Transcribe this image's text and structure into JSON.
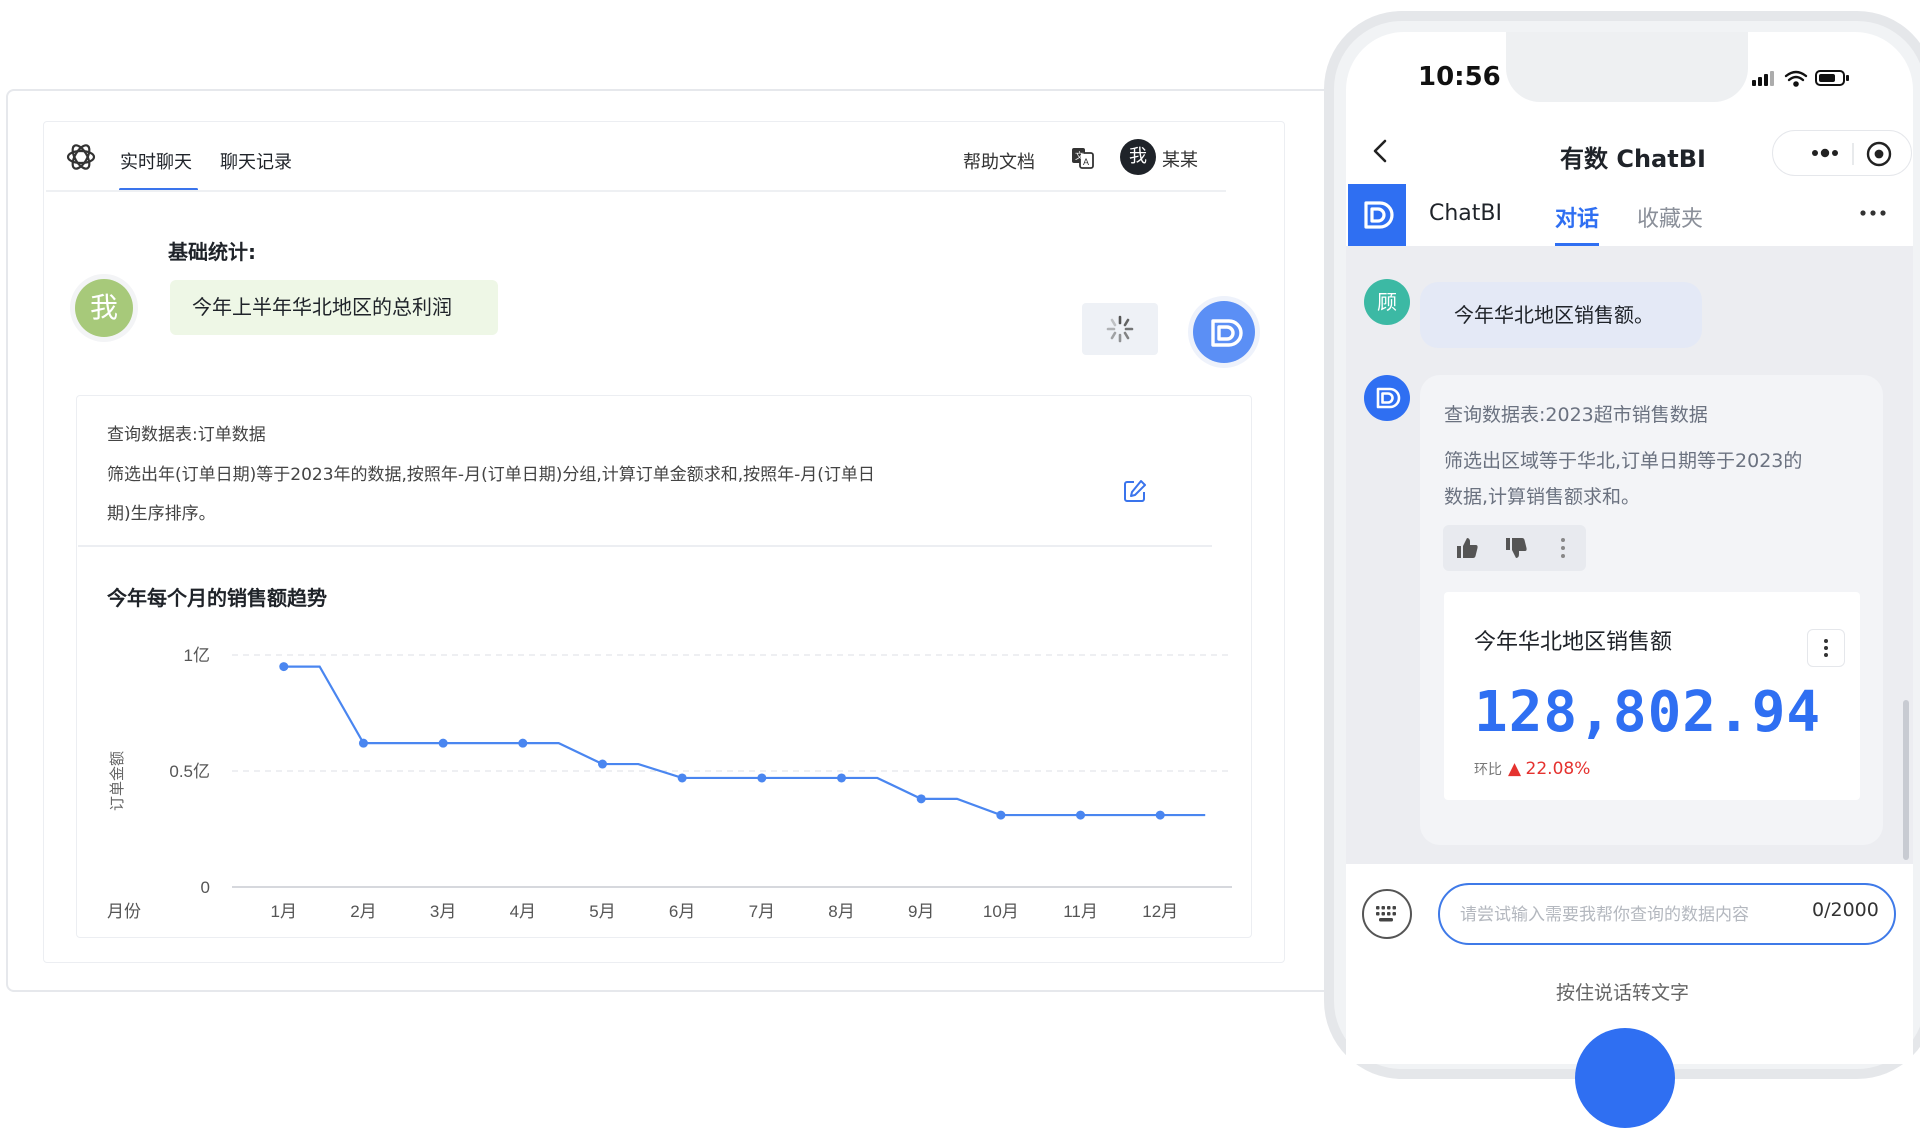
{
  "desktop": {
    "tabs": [
      {
        "label": "实时聊天",
        "active": true
      },
      {
        "label": "聊天记录",
        "active": false
      }
    ],
    "help_label": "帮助文档",
    "user": {
      "avatar_text": "我",
      "name": "某某"
    },
    "section_title": "基础统计:",
    "user_avatar_text": "我",
    "user_message": "今年上半年华北地区的总利润",
    "query": {
      "line1": "查询数据表:订单数据",
      "line2": "筛选出年(订单日期)等于2023年的数据,按照年-月(订单日期)分组,计算订单金额求和,按照年-月(订单日",
      "line3": "期)生序排序。"
    }
  },
  "chart_data": {
    "type": "line",
    "title": "今年每个月的销售额趋势",
    "xlabel": "月份",
    "ylabel": "订单金额",
    "categories": [
      "1月",
      "2月",
      "3月",
      "4月",
      "5月",
      "6月",
      "7月",
      "8月",
      "9月",
      "10月",
      "11月",
      "12月"
    ],
    "series": [
      {
        "values": [
          0.95,
          0.62,
          0.62,
          0.62,
          0.53,
          0.47,
          0.47,
          0.47,
          0.38,
          0.31,
          0.31,
          0.31
        ]
      }
    ],
    "y_tick_labels": [
      "0",
      "0.5亿",
      "1亿"
    ],
    "ylim": [
      0,
      1
    ],
    "grid": true,
    "color": "#4a86f0"
  },
  "phone": {
    "time": "10:56",
    "nav_title": "有数 ChatBI",
    "tabs": [
      {
        "label": "ChatBI",
        "active": false
      },
      {
        "label": "对话",
        "active": true
      },
      {
        "label": "收藏夹",
        "active": false
      }
    ],
    "user_avatar_text": "顾",
    "user_message": "今年华北地区销售额。",
    "answer": {
      "table": "查询数据表:2023超市销售数据",
      "line1": "筛选出区域等于华北,订单日期等于2023的",
      "line2": "数据,计算销售额求和。"
    },
    "metric": {
      "title": "今年华北地区销售额",
      "value": "128,802.94",
      "compare_label": "环比",
      "compare_value": "22.08%",
      "trend": "up"
    },
    "input": {
      "placeholder": "请尝试输入需要我帮你查询的数据内容",
      "value": "",
      "counter": "0/2000"
    },
    "hold_to_talk": "按住说话转文字"
  },
  "colors": {
    "accent": "#2f6ff2",
    "chart_line": "#4a86f0",
    "up": "#e5322f",
    "user_bubble": "#eef7e6"
  }
}
